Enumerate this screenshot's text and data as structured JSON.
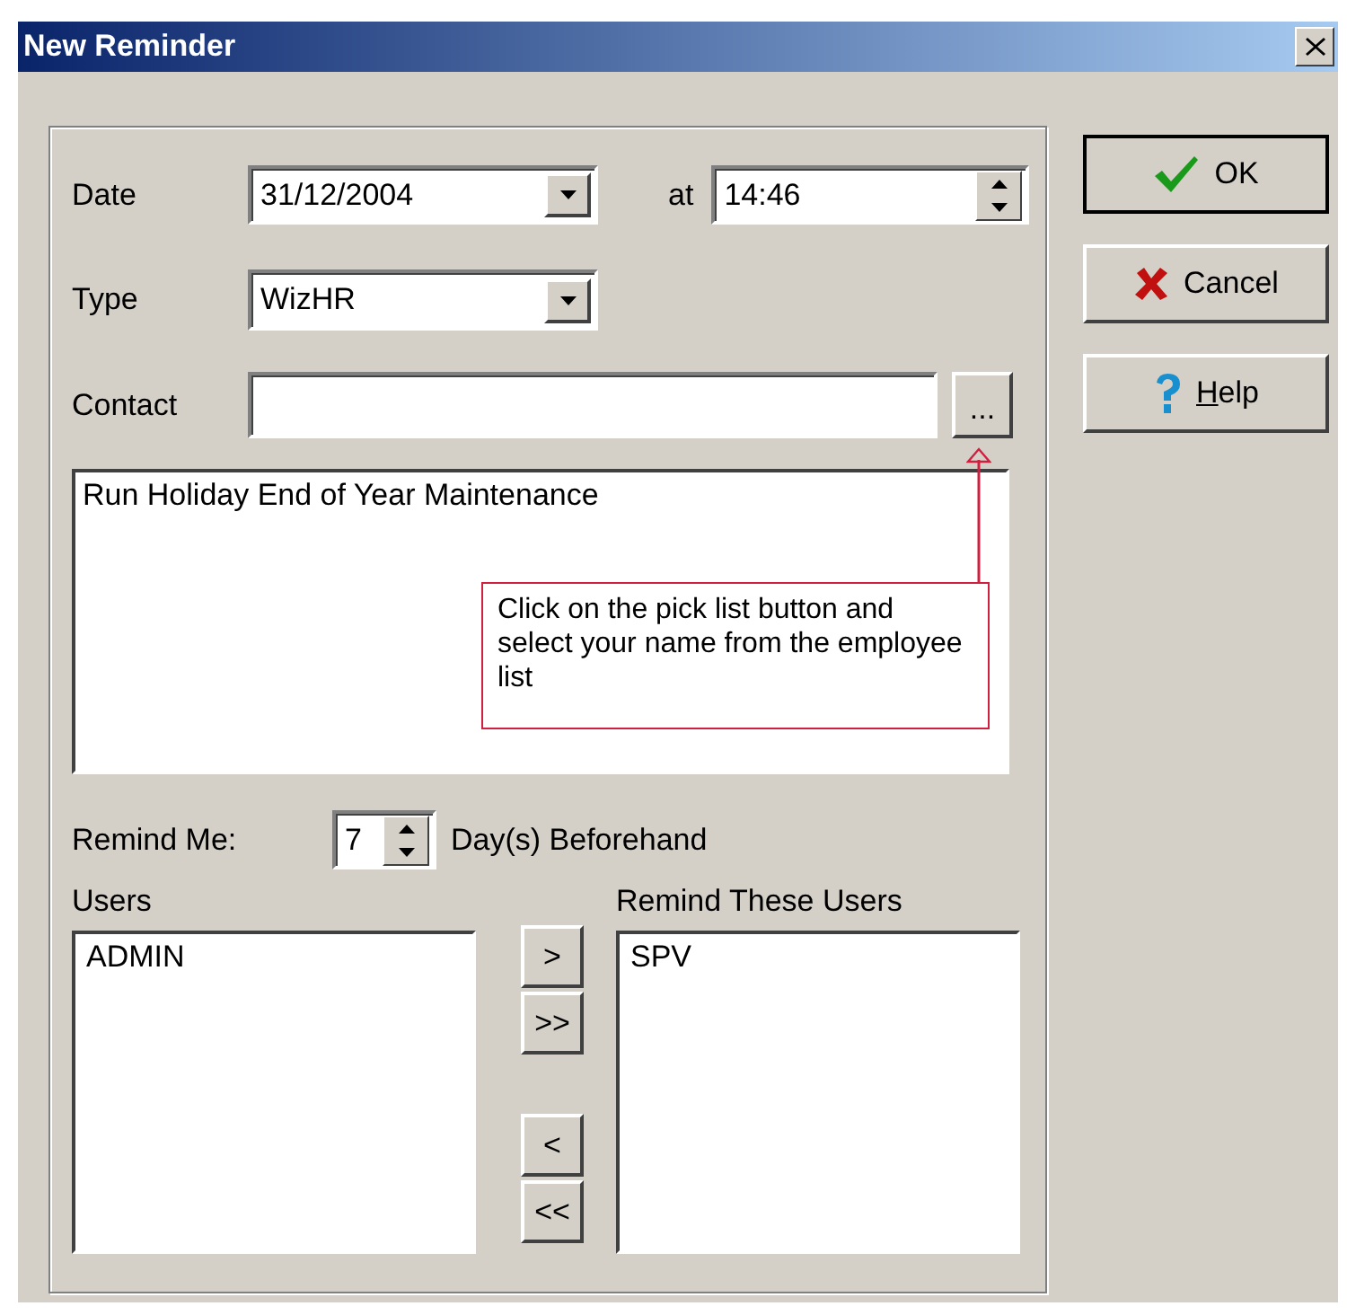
{
  "window": {
    "title": "New Reminder"
  },
  "form": {
    "date_label": "Date",
    "date_value": "31/12/2004",
    "at_label": "at",
    "time_value": "14:46",
    "type_label": "Type",
    "type_value": "WizHR",
    "contact_label": "Contact",
    "pick_button": "...",
    "memo": "Run Holiday End of Year Maintenance",
    "callout": "Click on the pick list button and select your name from the employee list",
    "remind_label": "Remind Me:",
    "remind_value": "7",
    "remind_suffix": "Day(s) Beforehand"
  },
  "users": {
    "label": "Users",
    "items": [
      "ADMIN"
    ]
  },
  "remind_users": {
    "label": "Remind These Users",
    "items": [
      "SPV"
    ]
  },
  "transfer_buttons": [
    ">",
    ">>",
    "<",
    "<<"
  ],
  "buttons": [
    {
      "kind": "ok",
      "label": "OK"
    },
    {
      "kind": "cancel",
      "label": "Cancel"
    },
    {
      "kind": "help",
      "accel": "H",
      "label": "elp"
    }
  ]
}
